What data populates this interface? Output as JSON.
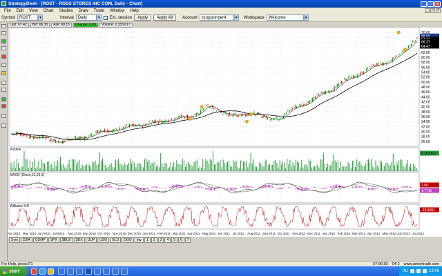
{
  "window": {
    "title": "StrategyDesk - [ROST - ROSS STORES INC COM, Daily - Chart]",
    "minimize": "_",
    "maximize": "□",
    "close": "x"
  },
  "menu": {
    "items": [
      "File",
      "Edit",
      "View",
      "Chart",
      "Studies",
      "Draw",
      "Trade",
      "Window",
      "Help"
    ]
  },
  "toolbar": {
    "symbol_label": "Symbol",
    "symbol_value": "ROST",
    "interval_label": "Interval",
    "interval_value": "Daily",
    "ext_session_label": "Ext. session",
    "apply_label": "Apply",
    "apply_all_label": "Apply All",
    "account_label": "Account",
    "account_value": "zzupizonder4",
    "workspace_label": "Workspace",
    "workspace_value": "Welcome"
  },
  "infobar": {
    "last": "Last: 67.42",
    "bid": "Bid: 66.30",
    "ask": "Ask: 68.15",
    "change": "Change: 0.09",
    "volume": "Volume: 2,153,617"
  },
  "panes": {
    "price_labels": {
      "last": "68.60",
      "open": "67.41",
      "low": "66.27",
      "close": "64.47"
    },
    "volume_label": "Volume",
    "volume_value": "2,153,617",
    "macd_label": "MACD (Close,12,26,9)",
    "macd_value": "1.06",
    "macd_value2": "1.7716",
    "williams_label": "Williams %R",
    "williams_value": "-33.8491"
  },
  "price_axis": [
    "70.00",
    "68.00",
    "66.00",
    "64.00",
    "62.00",
    "60.00",
    "58.00",
    "56.00",
    "54.00",
    "52.00",
    "50.00",
    "48.00",
    "46.00",
    "44.00",
    "42.00",
    "40.00",
    "38.00",
    "36.00",
    "34.00",
    "32.00",
    "30.00",
    "28.00",
    "26.00"
  ],
  "date_axis": [
    "Apr 2010",
    "May 2010",
    "Jun 2010",
    "Jul 2010",
    "Aug 2010",
    "Sep 2010",
    "Oct 2010",
    "Nov 2010",
    "Dec 2010",
    "Jan 2011",
    "Feb 2011",
    "Mar 2011",
    "Apr 2011",
    "May 2011",
    "Jun 2011",
    "Jul 2011",
    "Aug 2011",
    "Sep 2011",
    "Oct 2011",
    "Nov 2011",
    "Dec 2011",
    "Jan 2012",
    "Feb 2012",
    "Mar 2012",
    "Apr 2012",
    "May 2012",
    "Jun 2012",
    "Jul 2012"
  ],
  "tabs": [
    "Sym",
    "DJIA",
    "COMP",
    "SPX",
    "$BUX",
    "$DX",
    "UUP",
    "USO",
    "GLD",
    "DOO",
    "Inv",
    "1",
    "2",
    "3",
    "4",
    "5",
    "6",
    "7"
  ],
  "status": {
    "help": "For Help, press F1",
    "time": "07:06:50",
    "zoom": "04-2",
    "site": "www.ameritrade.com"
  },
  "taskbar": {
    "start": "start",
    "lang": "HU",
    "clock": "13:06"
  },
  "colors": {
    "candle_up": "#00a000",
    "candle_down": "#e00000",
    "ma_short": "#333333",
    "ma_long": "#000000",
    "macd_hist": "#c040c0",
    "williams": "#c00000"
  },
  "chart_data": {
    "type": "line",
    "title": "",
    "ylabel": "",
    "ylim": [
      24,
      72
    ],
    "x_range": [
      "Apr 2010",
      "Jul 2012"
    ],
    "series": [
      {
        "values": [
          29,
          28.5,
          27.5,
          26,
          26.5,
          28,
          30,
          31,
          32,
          33,
          34,
          35.5,
          36,
          40,
          38,
          36,
          38,
          35,
          36,
          40,
          43,
          46,
          50,
          53,
          56,
          58,
          62,
          68
        ]
      }
    ]
  }
}
